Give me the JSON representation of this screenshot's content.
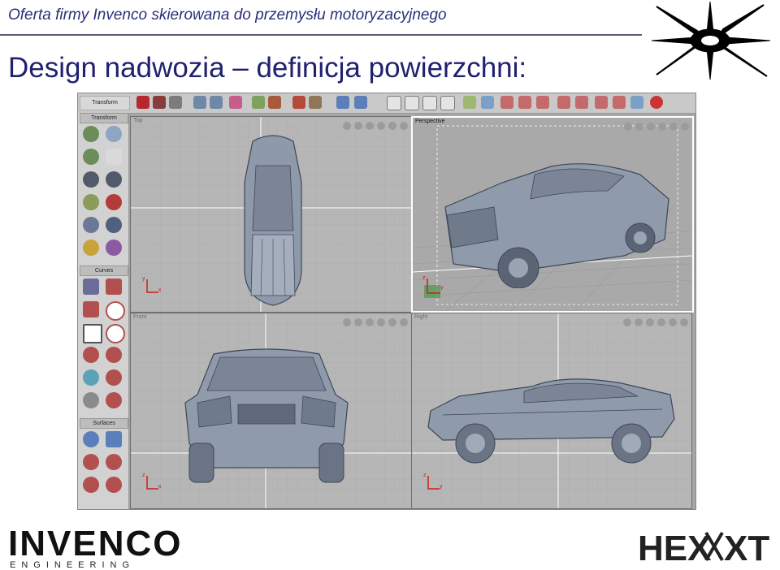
{
  "header": {
    "subtitle": "Oferta firmy Invenco skierowana do przemysłu motoryzacyjnego",
    "title": "Design nadwozia – definicja powierzchni:"
  },
  "screenshot": {
    "palette_sections": [
      "Transform",
      "Curves",
      "Surfaces"
    ],
    "toolbar_tab": "Transform",
    "viewports": {
      "top": "Top",
      "perspective": "Perspective",
      "front": "Front",
      "right": "Right"
    },
    "axes": {
      "top": [
        "y",
        "x"
      ],
      "perspective": [
        "z",
        "y"
      ],
      "front": [
        "z",
        "x"
      ],
      "right": [
        "z",
        "y"
      ]
    }
  },
  "footer": {
    "left_logo": "INVENCO",
    "left_logo_sub": "ENGINEERING",
    "right_logo": "HEXNEXT"
  },
  "colors": {
    "title_blue": "#1f2170",
    "header_blue": "#2a2f7a",
    "axis_red": "#c8201e",
    "viewport_grey": "#b6b6b6"
  }
}
